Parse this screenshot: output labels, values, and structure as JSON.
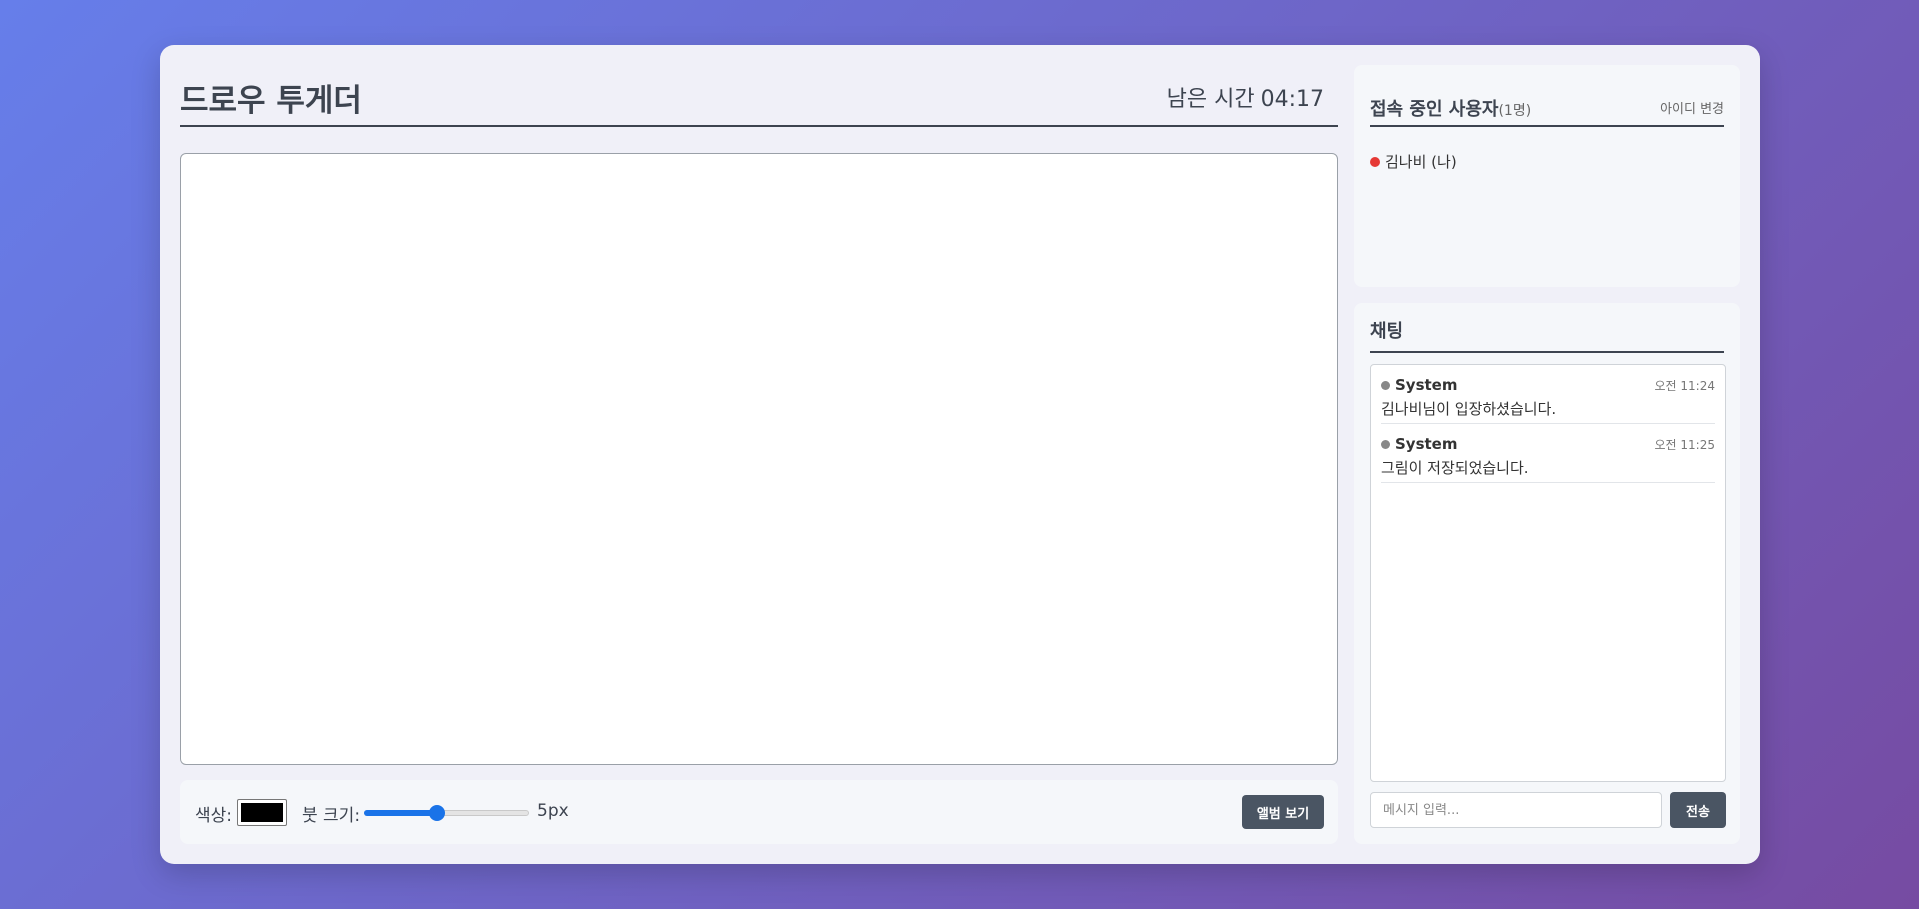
{
  "app": {
    "title": "드로우 투게더",
    "timer_label": "남은 시간",
    "timer_value": "04:17"
  },
  "toolbar": {
    "color_label": "색상:",
    "color_value": "#000000",
    "brush_label": "붓 크기:",
    "brush_size": 5,
    "brush_min": 1,
    "brush_max": 10,
    "brush_display": "5px",
    "album_button": "앨범 보기"
  },
  "users": {
    "title": "접속 중인 사용자",
    "count": "(1명)",
    "change_id": "아이디 변경",
    "list": [
      {
        "name": "김나비 (나)",
        "status_color": "#e53935"
      }
    ]
  },
  "chat": {
    "title": "채팅",
    "messages": [
      {
        "sender": "System",
        "time": "오전 11:24",
        "text": "김나비님이 입장하셨습니다.",
        "dot_color": "#888888"
      },
      {
        "sender": "System",
        "time": "오전 11:25",
        "text": "그림이 저장되었습니다.",
        "dot_color": "#888888"
      }
    ],
    "input_placeholder": "메시지 입력...",
    "send_button": "전송"
  }
}
